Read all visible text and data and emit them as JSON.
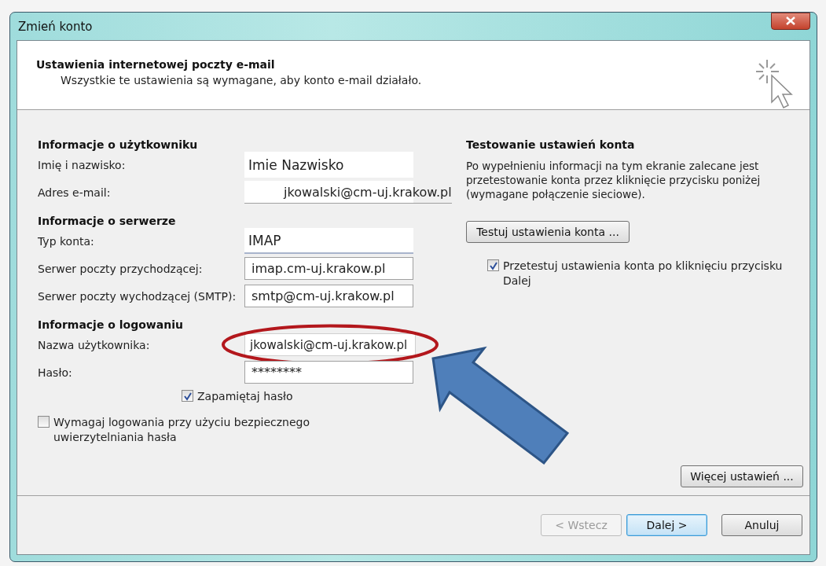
{
  "window": {
    "title": "Zmień konto"
  },
  "header": {
    "title": "Ustawienia internetowej poczty e-mail",
    "subtitle": "Wszystkie te ustawienia są wymagane, aby konto e-mail działało."
  },
  "sections": [
    {
      "heading": "Informacje o użytkowniku",
      "fields": [
        {
          "label": "Imię i nazwisko:",
          "value": "Imie Nazwisko",
          "kind": "plain"
        },
        {
          "label": "Adres e-mail:",
          "value": "jkowalski@cm-uj.krakow.pl",
          "kind": "shifted"
        }
      ]
    },
    {
      "heading": "Informacje o serwerze",
      "fields": [
        {
          "label": "Typ konta:",
          "value": "IMAP",
          "kind": "plain"
        },
        {
          "label": "Serwer poczty przychodzącej:",
          "value": "imap.cm-uj.krakow.pl",
          "kind": "boxed"
        },
        {
          "label": "Serwer poczty wychodzącej (SMTP):",
          "value": "smtp@cm-uj.krakow.pl",
          "kind": "boxed"
        }
      ]
    },
    {
      "heading": "Informacje o logowaniu",
      "fields": [
        {
          "label": "Nazwa użytkownika:",
          "value": "jkowalski@cm-uj.krakow.pl",
          "kind": "highlighted"
        },
        {
          "label": "Hasło:",
          "value": "********",
          "kind": "boxed"
        }
      ]
    }
  ],
  "remember_password": {
    "label": "Zapamiętaj hasło",
    "checked": true
  },
  "secure_auth": {
    "label": "Wymagaj logowania przy użyciu bezpiecznego uwierzytelniania hasła",
    "checked": false
  },
  "test": {
    "heading": "Testowanie ustawień konta",
    "text": "Po wypełnieniu informacji na tym ekranie zalecane jest przetestowanie konta przez kliknięcie przycisku poniżej (wymagane połączenie sieciowe).",
    "button": "Testuj ustawienia konta ...",
    "checkbox": {
      "label": "Przetestuj ustawienia konta po kliknięciu przycisku Dalej",
      "checked": true
    }
  },
  "more_button": "Więcej ustawień ...",
  "footer_buttons": [
    {
      "label": "< Wstecz",
      "disabled": true,
      "default": false
    },
    {
      "label": "Dalej >",
      "disabled": false,
      "default": true
    },
    {
      "label": "Anuluj",
      "disabled": false,
      "default": false
    }
  ]
}
